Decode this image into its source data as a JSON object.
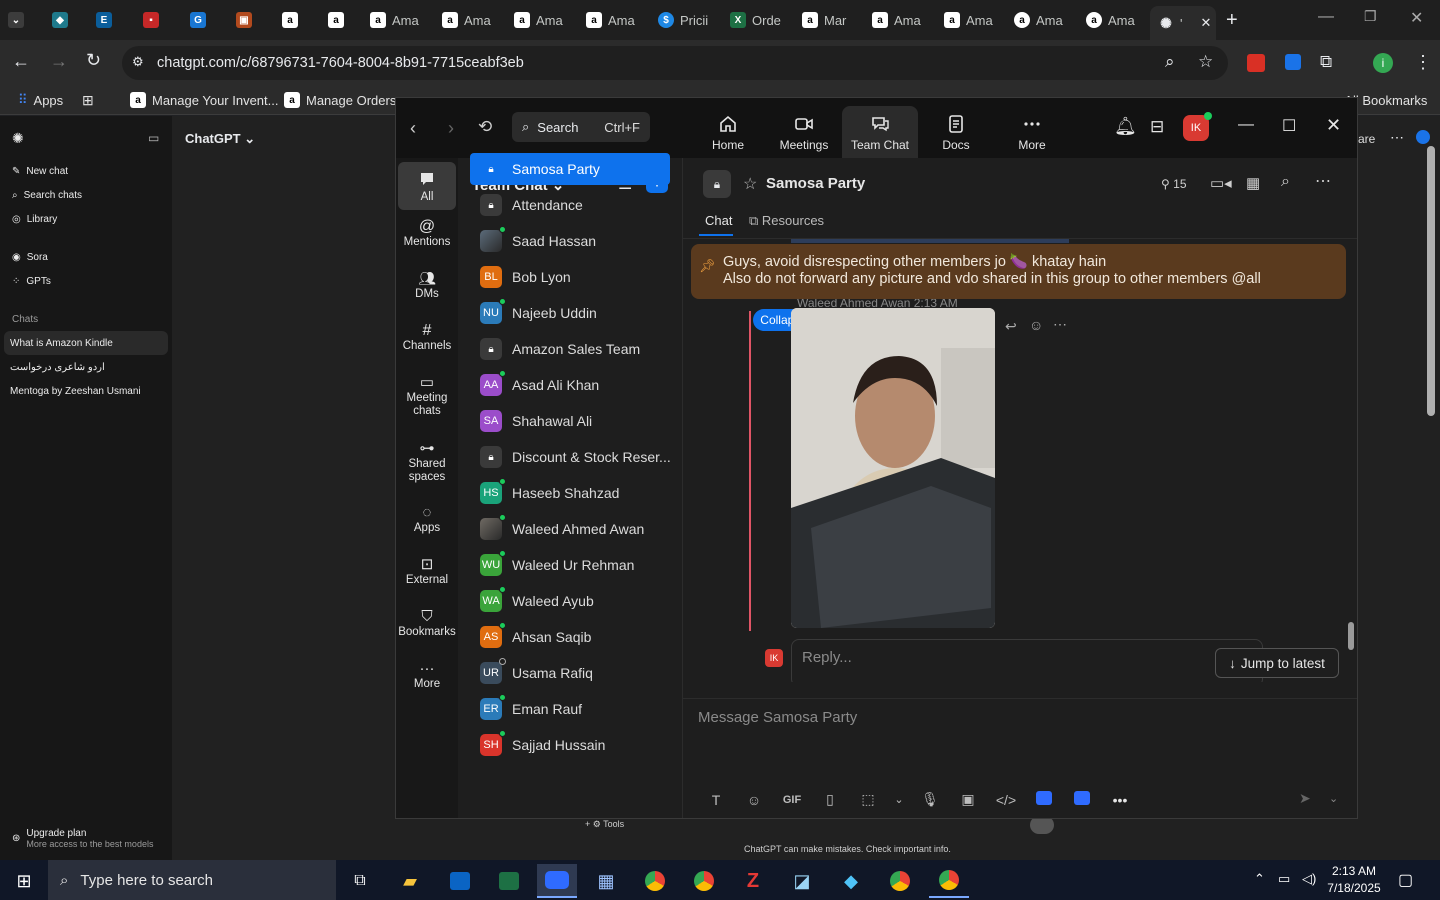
{
  "browser": {
    "tabs": [
      {
        "label": "",
        "icon": "chevron-down-icon"
      },
      {
        "label": "",
        "icon": "kite-icon"
      },
      {
        "label": "",
        "icon": "ec-icon"
      },
      {
        "label": "",
        "icon": "red-app-icon"
      },
      {
        "label": "",
        "icon": "g-icon"
      },
      {
        "label": "",
        "icon": "cube-icon"
      },
      {
        "label": "",
        "icon": "amazon-icon"
      },
      {
        "label": "",
        "icon": "amazon-icon"
      },
      {
        "label": "Ama",
        "icon": "amazon-icon"
      },
      {
        "label": "Ama",
        "icon": "amazon-icon"
      },
      {
        "label": "Ama",
        "icon": "amazon-icon"
      },
      {
        "label": "Ama",
        "icon": "amazon-icon"
      },
      {
        "label": "Pricii",
        "icon": "dollar-icon"
      },
      {
        "label": "Orde",
        "icon": "excel-icon"
      },
      {
        "label": "Mar",
        "icon": "amazon-icon"
      },
      {
        "label": "Ama",
        "icon": "amazon-icon"
      },
      {
        "label": "Ama",
        "icon": "amazon-icon"
      },
      {
        "label": "Ama",
        "icon": "amazon-icon"
      },
      {
        "label": "Ama",
        "icon": "amazon-icon"
      },
      {
        "label": "'",
        "icon": "openai-icon"
      }
    ],
    "url": "chatgpt.com/c/68796731-7604-8004-8b91-7715ceabf3eb",
    "bookmarks": [
      {
        "label": "Apps"
      },
      {
        "label": ""
      },
      {
        "label": "Manage Your Invent..."
      },
      {
        "label": "Manage Orders"
      }
    ],
    "all_bookmarks": "All Bookmarks",
    "profile_initial": "i"
  },
  "chatgpt": {
    "title": "ChatGPT",
    "new_chat": "New chat",
    "search_chats": "Search chats",
    "library": "Library",
    "sora": "Sora",
    "gpts": "GPTs",
    "chats_heading": "Chats",
    "chats": [
      "What is Amazon Kindle",
      "اردو شاعری درخواست",
      "Mentoga by Zeeshan Usmani"
    ],
    "upgrade": "Upgrade plan",
    "upgrade_sub": "More access to the best models",
    "share": "are",
    "disclaimer": "ChatGPT can make mistakes. Check important info.",
    "tools": "Tools"
  },
  "zoom": {
    "search_label": "Search",
    "search_shortcut": "Ctrl+F",
    "nav": [
      "Home",
      "Meetings",
      "Team Chat",
      "Docs",
      "More"
    ],
    "avatar_initials": "IK",
    "rail": [
      "All",
      "Mentions",
      "DMs",
      "Channels",
      "Meeting chats",
      "Shared spaces",
      "Apps",
      "External",
      "Bookmarks",
      "More"
    ],
    "list_title": "Team Chat",
    "conversations": [
      {
        "name": "Samosa Party",
        "type": "lock",
        "initials": "",
        "color": "#0e72ed",
        "status": "none"
      },
      {
        "name": "Attendance",
        "type": "lock",
        "initials": "",
        "color": "#3a3a3a",
        "status": "none"
      },
      {
        "name": "Saad Hassan",
        "type": "photo",
        "initials": "",
        "color": "#5b6b7a",
        "status": "online"
      },
      {
        "name": "Bob Lyon",
        "type": "initials",
        "initials": "BL",
        "color": "#e06d10",
        "status": "none"
      },
      {
        "name": "Najeeb Uddin",
        "type": "initials",
        "initials": "NU",
        "color": "#2b7bb9",
        "status": "online"
      },
      {
        "name": "Amazon Sales Team",
        "type": "lock",
        "initials": "",
        "color": "#3a3a3a",
        "status": "none"
      },
      {
        "name": "Asad Ali Khan",
        "type": "initials",
        "initials": "AA",
        "color": "#9b4dca",
        "status": "online"
      },
      {
        "name": "Shahawal Ali",
        "type": "initials",
        "initials": "SA",
        "color": "#9b4dca",
        "status": "none"
      },
      {
        "name": "Discount & Stock Reser...",
        "type": "lock",
        "initials": "",
        "color": "#3a3a3a",
        "status": "none"
      },
      {
        "name": "Haseeb Shahzad",
        "type": "initials",
        "initials": "HS",
        "color": "#1aa37a",
        "status": "online"
      },
      {
        "name": "Waleed Ahmed Awan",
        "type": "photo",
        "initials": "",
        "color": "#6f6a63",
        "status": "online"
      },
      {
        "name": "Waleed Ur Rehman",
        "type": "initials",
        "initials": "WU",
        "color": "#3aa43a",
        "status": "online"
      },
      {
        "name": "Waleed Ayub",
        "type": "initials",
        "initials": "WA",
        "color": "#3aa43a",
        "status": "online"
      },
      {
        "name": "Ahsan Saqib",
        "type": "initials",
        "initials": "AS",
        "color": "#e06d10",
        "status": "online"
      },
      {
        "name": "Usama Rafiq",
        "type": "initials",
        "initials": "UR",
        "color": "#3a4b5c",
        "status": "offline"
      },
      {
        "name": "Eman Rauf",
        "type": "initials",
        "initials": "ER",
        "color": "#2b7bb9",
        "status": "online"
      },
      {
        "name": "Sajjad Hussain",
        "type": "initials",
        "initials": "SH",
        "color": "#d9342b",
        "status": "online"
      }
    ],
    "chat": {
      "title": "Samosa Party",
      "member_count": "15",
      "tab_chat": "Chat",
      "tab_resources": "Resources",
      "pinned_line1": "Guys, avoid disrespecting other members jo 🍆 khatay hain",
      "pinned_line2": "Also do not forward any picture and vdo shared in this group to other members @all",
      "sender_partial": "Waleed Ahmed Awan 2:13 AM",
      "collapse_all": "Collapse all",
      "reply_placeholder": "Reply...",
      "reply_avatar": "IK",
      "jump_latest": "Jump to latest",
      "composer_placeholder": "Message Samosa Party",
      "gif": "GIF"
    }
  },
  "taskbar": {
    "search_placeholder": "Type here to search",
    "time": "2:13 AM",
    "date": "7/18/2025"
  }
}
